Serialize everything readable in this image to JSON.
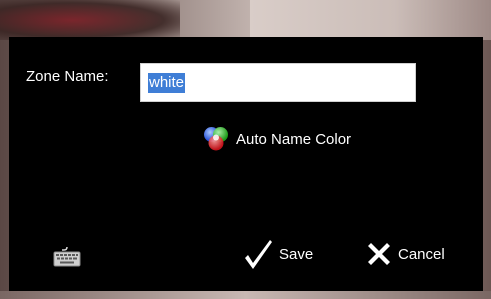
{
  "dialog": {
    "zone_name_label": "Zone Name:",
    "zone_name_value": "white",
    "auto_name_color_label": "Auto Name Color",
    "keyboard_icon": "keyboard-icon",
    "save_label": "Save",
    "cancel_label": "Cancel"
  },
  "colors": {
    "dialog_background": "#000000",
    "text": "#ffffff",
    "selection": "#3f7ed6",
    "input_background": "#ffffff"
  }
}
